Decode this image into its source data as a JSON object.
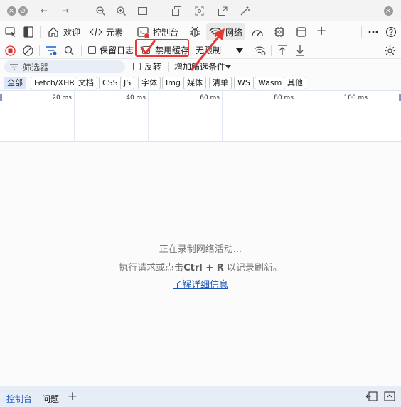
{
  "tabs": {
    "welcome": "欢迎",
    "elements": "元素",
    "console": "控制台",
    "network": "网络"
  },
  "toolbar": {
    "preserve_log": "保留日志",
    "disable_cache": "禁用缓存",
    "throttle": "无限制"
  },
  "filter": {
    "placeholder": "筛选器",
    "invert": "反转",
    "more_filters": "增加筛选条件"
  },
  "chips": [
    "全部",
    "Fetch/XHR",
    "文档",
    "CSS",
    "JS",
    "字体",
    "Img",
    "媒体",
    "清单",
    "WS",
    "Wasm",
    "其他"
  ],
  "timeline": {
    "ticks": [
      "20 ms",
      "40 ms",
      "60 ms",
      "80 ms",
      "100 ms"
    ]
  },
  "empty": {
    "line1": "正在录制网络活动...",
    "line2_prefix": "执行请求或点击",
    "line2_key": "Ctrl + R",
    "line2_suffix": "以记录刷新。",
    "link": "了解详细信息"
  },
  "bottom": {
    "console": "控制台",
    "issues": "问题"
  },
  "colors": {
    "accent": "#1a5fd0",
    "annotation": "#e53935",
    "record": "#d93025"
  }
}
